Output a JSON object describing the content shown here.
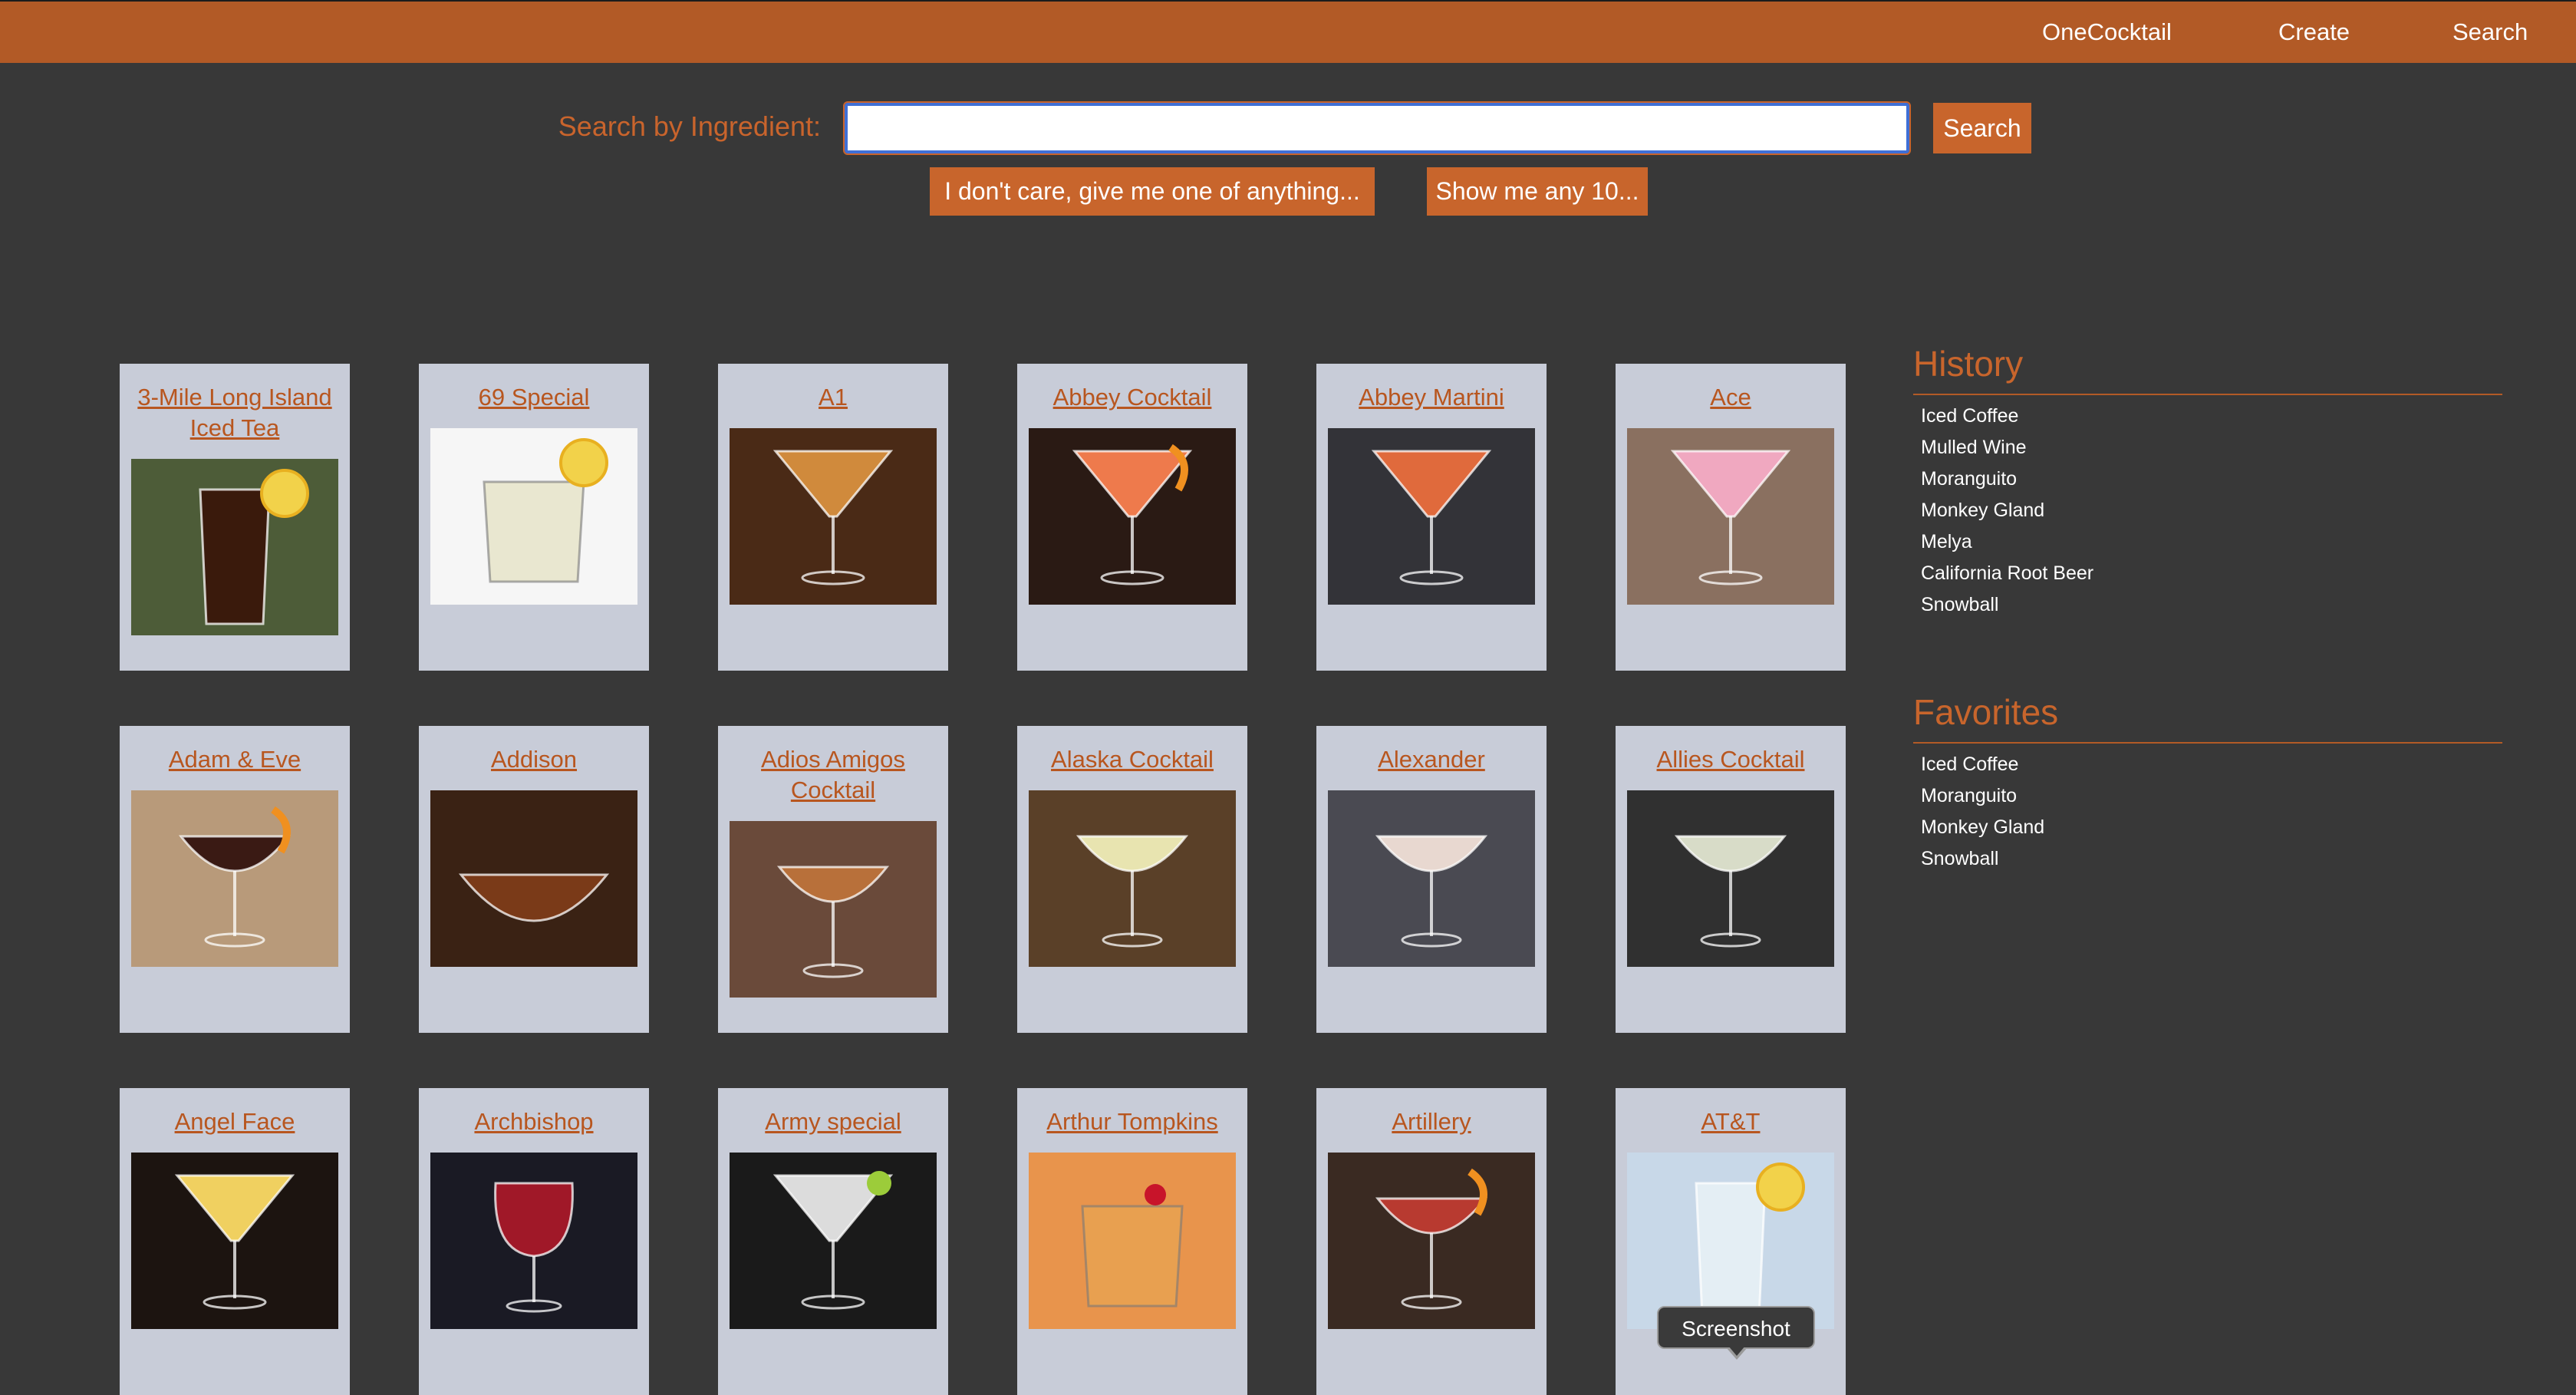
{
  "nav": {
    "brand": "OneCocktail",
    "create": "Create",
    "search": "Search"
  },
  "search": {
    "label": "Search by Ingredient:",
    "value": "",
    "placeholder": "",
    "button": "Search",
    "random_one": "I don't care, give me one of anything...",
    "random_ten": "Show me any 10..."
  },
  "colors": {
    "topbar": "#b25a26",
    "accent": "#c8652c",
    "background": "#383838",
    "card": "#c8ccd8",
    "link": "#b8561f"
  },
  "cocktails": [
    {
      "name": "3-Mile Long Island Iced Tea",
      "image": "iced-tea-highball",
      "bg": "#4d5c38",
      "glass": "highball",
      "liquid": "#3a1a0c",
      "garnish": "lemon"
    },
    {
      "name": "69 Special",
      "image": "rocks-glass-lemon",
      "bg": "#f6f6f6",
      "glass": "rocks",
      "liquid": "#e9e7d0",
      "garnish": "lemon"
    },
    {
      "name": "A1",
      "image": "martini-amber",
      "bg": "#4a2a16",
      "glass": "martini",
      "liquid": "#d08a3c",
      "garnish": "none"
    },
    {
      "name": "Abbey Cocktail",
      "image": "martini-orange-twist",
      "bg": "#2a1a14",
      "glass": "martini",
      "liquid": "#ee7a4c",
      "garnish": "orange"
    },
    {
      "name": "Abbey Martini",
      "image": "martini-orange-dark",
      "bg": "#333338",
      "glass": "martini",
      "liquid": "#e06a3c",
      "garnish": "none"
    },
    {
      "name": "Ace",
      "image": "martini-pink-plaid",
      "bg": "#8a7060",
      "glass": "martini",
      "liquid": "#f0a8c0",
      "garnish": "none"
    },
    {
      "name": "Adam & Eve",
      "image": "coupe-dark-orange-peel",
      "bg": "#b89a7a",
      "glass": "coupe",
      "liquid": "#3a1a14",
      "garnish": "orange"
    },
    {
      "name": "Addison",
      "image": "pour-amber",
      "bg": "#3a2214",
      "glass": "wide",
      "liquid": "#7a3a18",
      "garnish": "none"
    },
    {
      "name": "Adios Amigos Cocktail",
      "image": "coupe-amber",
      "bg": "#6a4a3a",
      "glass": "coupe",
      "liquid": "#b8703a",
      "garnish": "none"
    },
    {
      "name": "Alaska Cocktail",
      "image": "coupe-pale-bottles",
      "bg": "#5a4028",
      "glass": "coupe",
      "liquid": "#e8e4b0",
      "garnish": "none"
    },
    {
      "name": "Alexander",
      "image": "two-coupes-cream",
      "bg": "#4a4a52",
      "glass": "coupe",
      "liquid": "#e8d8d0",
      "garnish": "none"
    },
    {
      "name": "Allies Cocktail",
      "image": "coupe-clear-tomatoes",
      "bg": "#303030",
      "glass": "coupe",
      "liquid": "#d8dcc8",
      "garnish": "none"
    },
    {
      "name": "Angel Face",
      "image": "martini-yellow",
      "bg": "#1c1410",
      "glass": "martini",
      "liquid": "#f0d060",
      "garnish": "none"
    },
    {
      "name": "Archbishop",
      "image": "goblet-red",
      "bg": "#1a1a24",
      "glass": "goblet",
      "liquid": "#a01828",
      "garnish": "none"
    },
    {
      "name": "Army special",
      "image": "martini-clear-lime",
      "bg": "#1a1a1a",
      "glass": "martini",
      "liquid": "#dcdcdc",
      "garnish": "lime"
    },
    {
      "name": "Arthur Tompkins",
      "image": "rocks-orange-cherry",
      "bg": "#e8944c",
      "glass": "rocks",
      "liquid": "#e8a050",
      "garnish": "cherry"
    },
    {
      "name": "Artillery",
      "image": "coupe-rose",
      "bg": "#3a2a22",
      "glass": "coupe",
      "liquid": "#b83a30",
      "garnish": "orange"
    },
    {
      "name": "AT&T",
      "image": "highball-clear-lemon",
      "bg": "#c8d8e8",
      "glass": "highball",
      "liquid": "#e4eef4",
      "garnish": "lemon"
    }
  ],
  "history": {
    "title": "History",
    "items": [
      "Iced Coffee",
      "Mulled Wine",
      "Moranguito",
      "Monkey Gland",
      "Melya",
      "California Root Beer",
      "Snowball"
    ]
  },
  "favorites": {
    "title": "Favorites",
    "items": [
      "Iced Coffee",
      "Moranguito",
      "Monkey Gland",
      "Snowball"
    ]
  },
  "tooltip": {
    "label": "Screenshot"
  }
}
